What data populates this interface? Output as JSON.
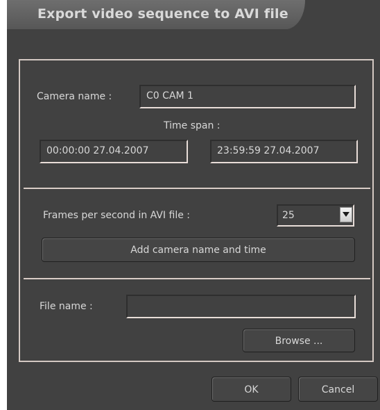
{
  "dialog": {
    "title": "Export video sequence to AVI file"
  },
  "camera": {
    "label": "Camera name :",
    "value": "C0 CAM 1"
  },
  "time_span": {
    "label": "Time span :",
    "start": "00:00:00 27.04.2007",
    "end": "23:59:59 27.04.2007"
  },
  "fps": {
    "label": "Frames per second in AVI file :",
    "selected": "25"
  },
  "add_name_time_label": "Add camera name and time",
  "file": {
    "label": "File name :",
    "value": "",
    "browse_label": "Browse ..."
  },
  "footer": {
    "ok_label": "OK",
    "cancel_label": "Cancel"
  },
  "icons": {
    "dropdown": "chevron-down-icon"
  },
  "colors": {
    "background": "#414141",
    "text": "#d8d8d8",
    "panel_border": "#d4c9c3"
  }
}
